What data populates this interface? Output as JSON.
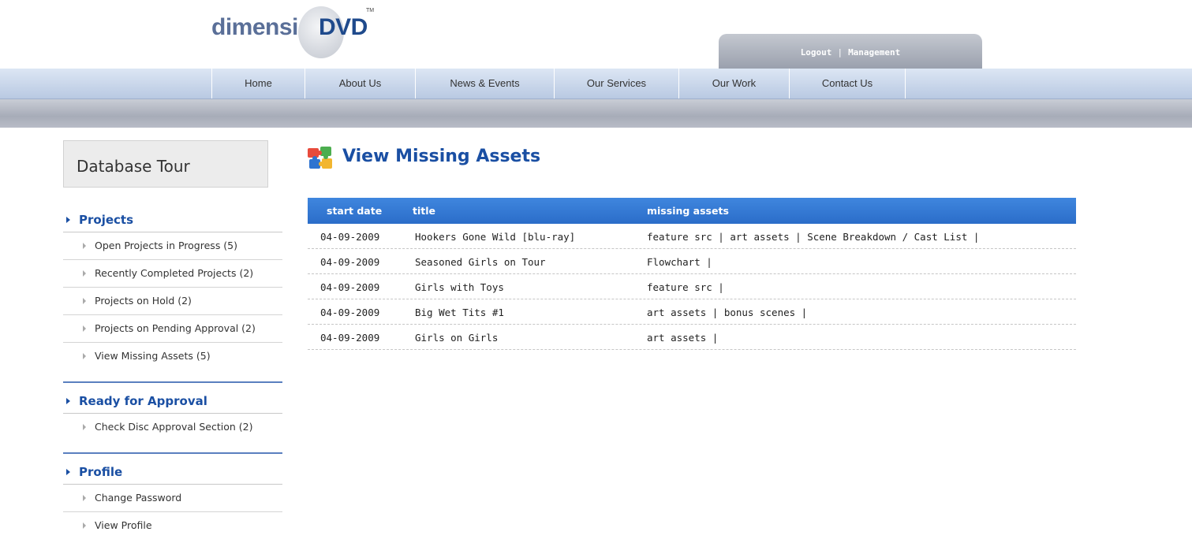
{
  "logo": {
    "part1": "dimensi",
    "part2": "DVD",
    "tm": "TM"
  },
  "top_links": {
    "logout": "Logout",
    "separator": "|",
    "management": "Management"
  },
  "nav": {
    "items": [
      "Home",
      "About Us",
      "News & Events",
      "Our Services",
      "Our Work",
      "Contact Us"
    ]
  },
  "sidebar": {
    "title": "Database Tour",
    "sections": [
      {
        "heading": "Projects",
        "items": [
          "Open Projects in Progress (5)",
          "Recently Completed Projects (2)",
          "Projects on Hold (2)",
          "Projects on Pending Approval (2)",
          "View Missing Assets (5)"
        ]
      },
      {
        "heading": "Ready for Approval",
        "items": [
          "Check Disc Approval Section (2)"
        ]
      },
      {
        "heading": "Profile",
        "items": [
          "Change Password",
          "View Profile"
        ]
      }
    ]
  },
  "main": {
    "title": "View Missing Assets",
    "table": {
      "headers": [
        "start date",
        "title",
        "missing assets"
      ],
      "rows": [
        [
          "04-09-2009",
          "Hookers Gone Wild [blu-ray]",
          "feature src | art assets | Scene Breakdown / Cast List |"
        ],
        [
          "04-09-2009",
          "Seasoned Girls on Tour",
          "Flowchart |"
        ],
        [
          "04-09-2009",
          "Girls with Toys",
          "feature src |"
        ],
        [
          "04-09-2009",
          "Big Wet Tits #1",
          "art assets | bonus scenes |"
        ],
        [
          "04-09-2009",
          "Girls on Girls",
          "art assets |"
        ]
      ]
    }
  },
  "colors": {
    "accent": "#1a4fa3",
    "table_header": "#2f74d0",
    "nav_bar": "#c8d6ec"
  }
}
